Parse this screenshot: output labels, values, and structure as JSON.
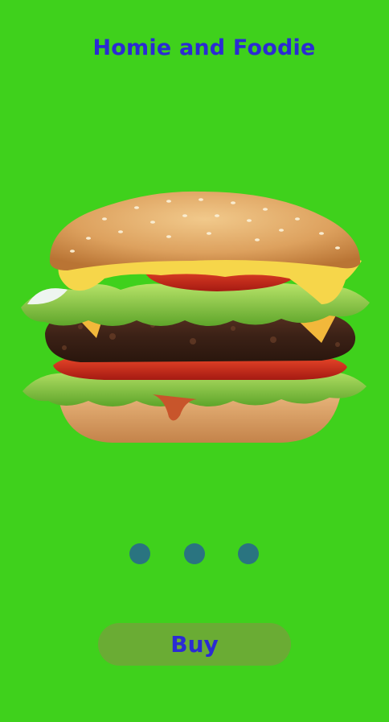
{
  "app": {
    "title": "Homie and Foodie"
  },
  "hero": {
    "image_name": "burger-image"
  },
  "carousel": {
    "page_count": 3,
    "dot_color": "#2a7480"
  },
  "actions": {
    "buy_label": "Buy",
    "buy_color": "#6aac34"
  },
  "theme": {
    "background": "#3fd11c",
    "accent_text": "#2b2bd4"
  }
}
